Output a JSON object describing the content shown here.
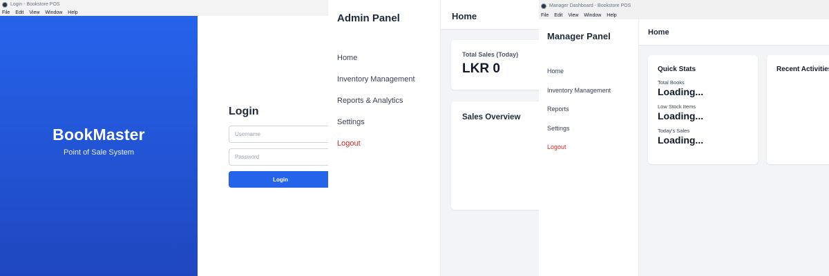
{
  "login_window": {
    "title": "Login - Bookstore POS",
    "menu": [
      "File",
      "Edit",
      "View",
      "Window",
      "Help"
    ],
    "brand": {
      "name": "BookMaster",
      "tagline": "Point of Sale System",
      "color": "#2563eb"
    },
    "form": {
      "heading": "Login",
      "username_placeholder": "Username",
      "password_placeholder": "Password",
      "submit_label": "Login"
    }
  },
  "admin_window": {
    "sidebar_title": "Admin Panel",
    "nav": [
      "Home",
      "Inventory Management",
      "Reports & Analytics",
      "Settings",
      "Logout"
    ],
    "header": "Home",
    "sales_card": {
      "label": "Total Sales (Today)",
      "value": "LKR 0"
    },
    "overview_card": {
      "heading": "Sales Overview"
    }
  },
  "manager_window": {
    "title": "Manager Dashboard - Bookstore POS",
    "menu": [
      "File",
      "Edit",
      "View",
      "Window",
      "Help"
    ],
    "sidebar_title": "Manager Panel",
    "nav": [
      "Home",
      "Inventory Management",
      "Reports",
      "Settings",
      "Logout"
    ],
    "header": "Home",
    "quick_stats": {
      "heading": "Quick Stats",
      "items": [
        {
          "label": "Total Books",
          "value": "Loading..."
        },
        {
          "label": "Low Stock Items",
          "value": "Loading..."
        },
        {
          "label": "Today's Sales",
          "value": "Loading..."
        }
      ]
    },
    "recent_activities": {
      "heading": "Recent Activities"
    }
  },
  "colors": {
    "accent": "#2563eb",
    "danger": "#dc2626",
    "content_bg": "#f3f4f6"
  }
}
